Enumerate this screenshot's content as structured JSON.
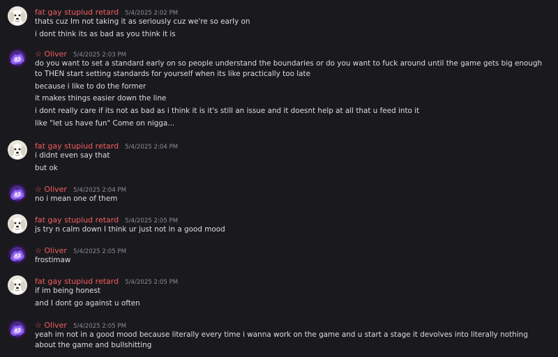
{
  "users": {
    "fatgay": {
      "display_name": "fat gay stupiud retard",
      "name_color": "#f25d5d",
      "avatar_icon": "dog-avatar-icon"
    },
    "oliver": {
      "display_name": "☆ Oliver",
      "name_color": "#f25d5d",
      "avatar_icon": "purple-fire-avatar-icon"
    }
  },
  "messages": [
    {
      "user": "fatgay",
      "name": "fat gay stupiud retard",
      "timestamp": "5/4/2025 2:02 PM",
      "lines": [
        "thats cuz Im not taking it as seriously  cuz we're so early on",
        "i dont think its as bad as you think it is"
      ]
    },
    {
      "user": "oliver",
      "name": "☆ Oliver",
      "timestamp": "5/4/2025 2:03 PM",
      "lines": [
        "do you want to set a standard early on so people understand the boundaries or do you want to fuck around until the game gets big enough to THEN start setting standards for yourself when its like practically too late",
        "because i like to do the former",
        "it makes things easier down the line",
        "i dont really care if its not as bad as i think it is it's still an issue and it doesnt help at all that u feed into it",
        "like \"let us have fun\" Come on nigga..."
      ]
    },
    {
      "user": "fatgay",
      "name": "fat gay stupiud retard",
      "timestamp": "5/4/2025 2:04 PM",
      "lines": [
        "i didnt even say that",
        "but ok"
      ]
    },
    {
      "user": "oliver",
      "name": "☆ Oliver",
      "timestamp": "5/4/2025 2:04 PM",
      "lines": [
        "no i mean one of them"
      ]
    },
    {
      "user": "fatgay",
      "name": "fat gay stupiud retard",
      "timestamp": "5/4/2025 2:05 PM",
      "lines": [
        "js try n calm down I think ur just not in a good mood"
      ]
    },
    {
      "user": "oliver",
      "name": "☆ Oliver",
      "timestamp": "5/4/2025 2:05 PM",
      "lines": [
        "frostimaw"
      ]
    },
    {
      "user": "fatgay",
      "name": "fat gay stupiud retard",
      "timestamp": "5/4/2025 2:05 PM",
      "lines": [
        "if im being honest",
        "and I dont go against u often"
      ]
    },
    {
      "user": "oliver",
      "name": "☆ Oliver",
      "timestamp": "5/4/2025 2:05 PM",
      "lines": [
        "yeah im not in a good mood because literally every time i wanna work on the game and u start a stage it devolves into literally nothing about the game and bullshitting"
      ]
    }
  ]
}
